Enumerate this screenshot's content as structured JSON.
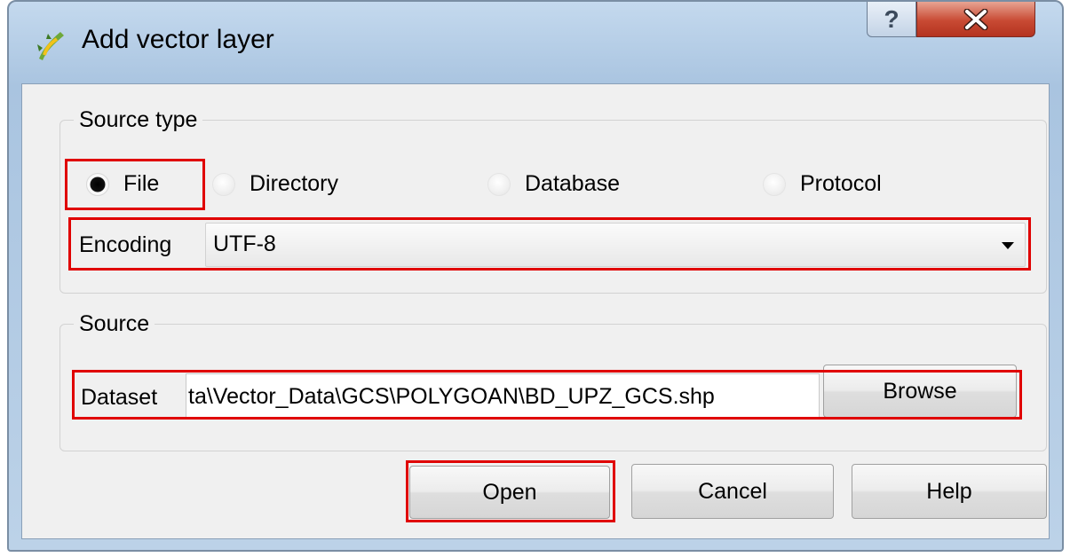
{
  "window": {
    "title": "Add vector layer",
    "help_icon_glyph": "?",
    "close_icon": "close-icon",
    "app_icon": "qgis-icon"
  },
  "source_type": {
    "legend": "Source type",
    "options": [
      {
        "label": "File",
        "selected": true
      },
      {
        "label": "Directory",
        "selected": false
      },
      {
        "label": "Database",
        "selected": false
      },
      {
        "label": "Protocol",
        "selected": false
      }
    ],
    "encoding_label": "Encoding",
    "encoding_value": "UTF-8"
  },
  "source": {
    "legend": "Source",
    "dataset_label": "Dataset",
    "dataset_value": "ta\\Vector_Data\\GCS\\POLYGOAN\\BD_UPZ_GCS.shp",
    "browse_label": "Browse"
  },
  "buttons": {
    "open": "Open",
    "cancel": "Cancel",
    "help": "Help"
  },
  "colors": {
    "highlight": "#e00000",
    "window_frame": "#a9c4e0",
    "close_button": "#c84a33"
  }
}
